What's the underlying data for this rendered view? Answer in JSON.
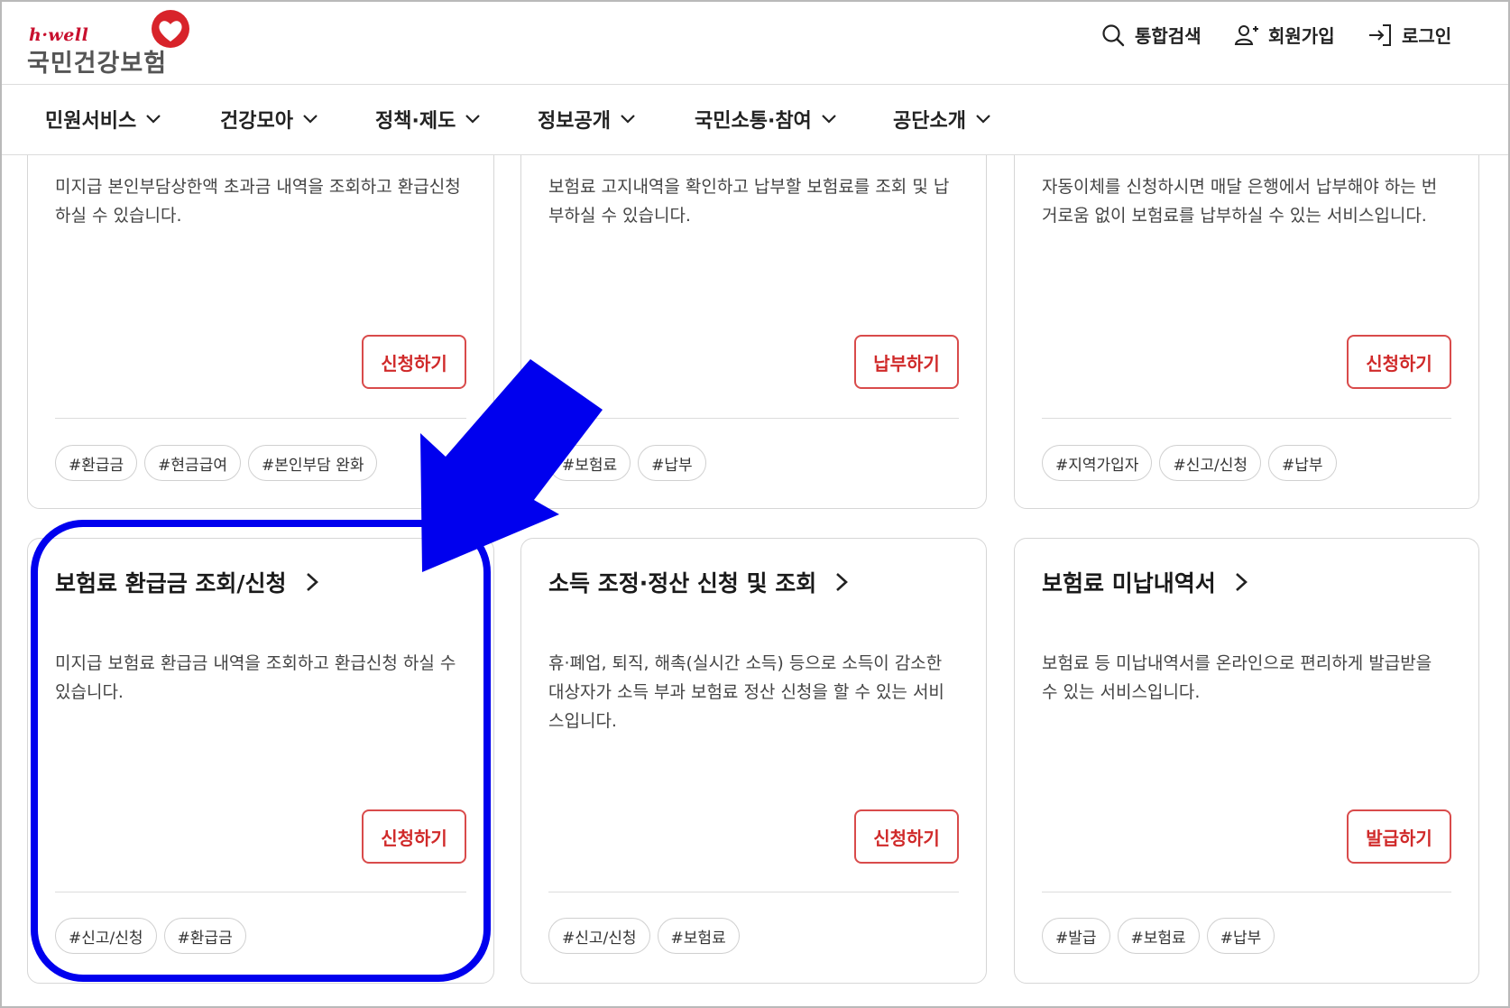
{
  "header": {
    "logo_small": "h·well",
    "logo_main": "국민건강보험",
    "search_label": "통합검색",
    "join_label": "회원가입",
    "login_label": "로그인"
  },
  "nav": {
    "items": [
      {
        "label": "민원서비스"
      },
      {
        "label": "건강모아"
      },
      {
        "label": "정책·제도"
      },
      {
        "label": "정보공개"
      },
      {
        "label": "국민소통·참여"
      },
      {
        "label": "공단소개"
      }
    ]
  },
  "cards_top": [
    {
      "desc": "미지급 본인부담상한액 초과금 내역을 조회하고 환급신청 하실 수 있습니다.",
      "button": "신청하기",
      "tags": [
        "#환급금",
        "#현금급여",
        "#본인부담 완화"
      ]
    },
    {
      "desc": "보험료 고지내역을 확인하고 납부할 보험료를 조회 및 납부하실 수 있습니다.",
      "button": "납부하기",
      "tags": [
        "#보험료",
        "#납부"
      ]
    },
    {
      "desc": "자동이체를 신청하시면 매달 은행에서 납부해야 하는 번거로움 없이 보험료를 납부하실 수 있는 서비스입니다.",
      "button": "신청하기",
      "tags": [
        "#지역가입자",
        "#신고/신청",
        "#납부"
      ]
    }
  ],
  "cards_bottom": [
    {
      "title": "보험료 환급금 조회/신청",
      "desc": "미지급 보험료 환급금 내역을 조회하고 환급신청 하실 수 있습니다.",
      "button": "신청하기",
      "tags": [
        "#신고/신청",
        "#환급금"
      ]
    },
    {
      "title": "소득 조정·정산 신청 및 조회",
      "desc": "휴·폐업, 퇴직, 해촉(실시간 소득) 등으로 소득이 감소한 대상자가 소득 부과 보험료 정산 신청을 할 수 있는 서비스입니다.",
      "button": "신청하기",
      "tags": [
        "#신고/신청",
        "#보험료"
      ]
    },
    {
      "title": "보험료 미납내역서",
      "desc": "보험료 등 미납내역서를 온라인으로 편리하게 발급받을 수 있는 서비스입니다.",
      "button": "발급하기",
      "tags": [
        "#발급",
        "#보험료",
        "#납부"
      ]
    }
  ],
  "colors": {
    "brand_red": "#c8102e",
    "button_border": "#d94b4b",
    "annotation_blue": "#0000ee"
  },
  "icons": {
    "search": "search-icon",
    "join": "user-plus-icon",
    "login": "login-icon",
    "nav_chevron": "chevron-down-icon",
    "title_chevron": "chevron-right-icon"
  }
}
